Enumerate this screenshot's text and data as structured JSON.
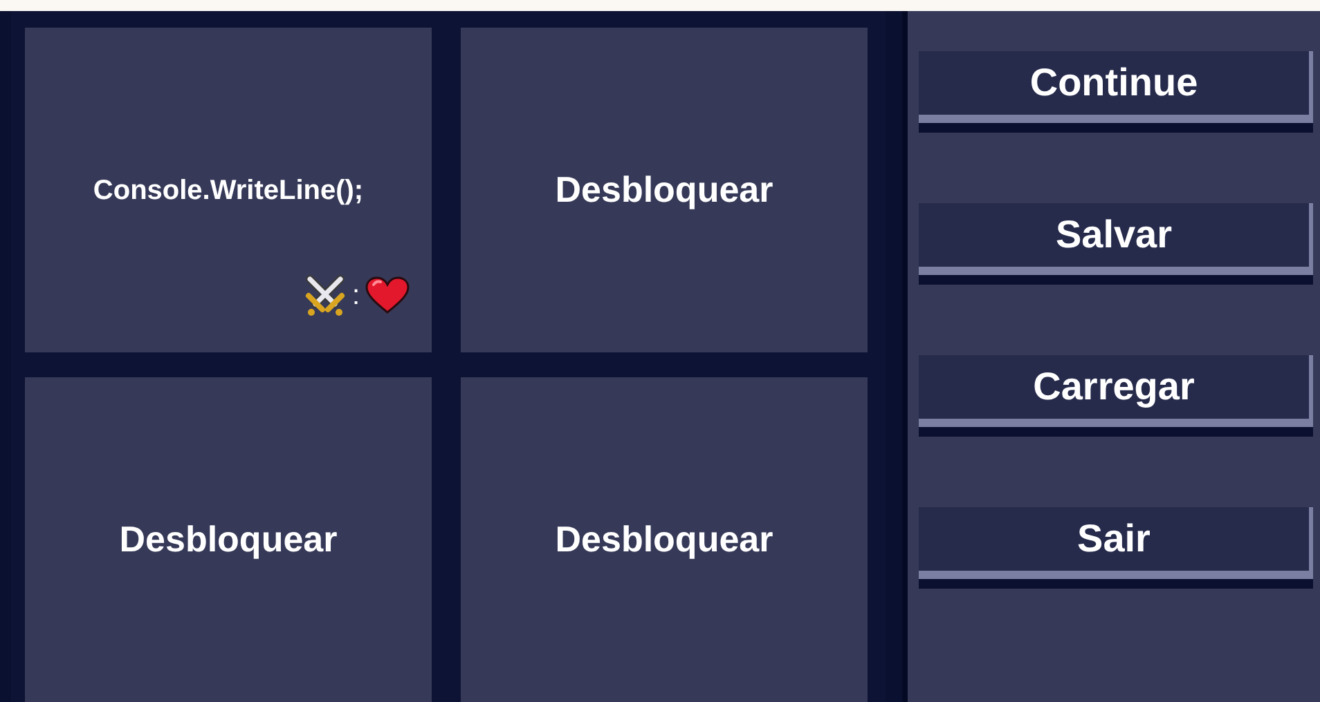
{
  "slots": [
    {
      "kind": "code",
      "text": "Console.WriteLine();",
      "separator": ":"
    },
    {
      "kind": "locked",
      "text": "Desbloquear"
    },
    {
      "kind": "locked",
      "text": "Desbloquear"
    },
    {
      "kind": "locked",
      "text": "Desbloquear"
    }
  ],
  "menu": [
    "Continue",
    "Salvar",
    "Carregar",
    "Sair"
  ]
}
